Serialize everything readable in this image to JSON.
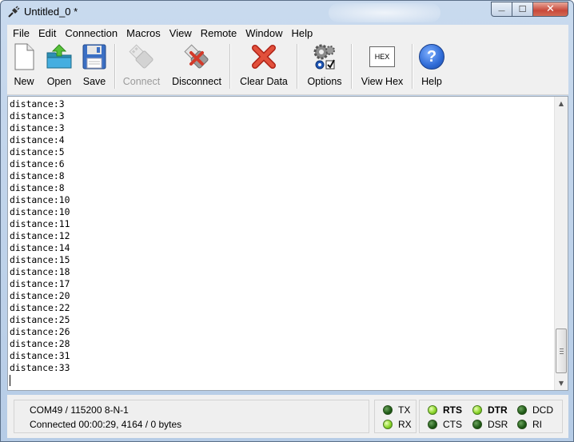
{
  "window": {
    "title": "Untitled_0 *",
    "close_glyph": "✕",
    "minimize_glyph": "—",
    "maximize_glyph": "☐"
  },
  "menu": [
    "File",
    "Edit",
    "Connection",
    "Macros",
    "View",
    "Remote",
    "Window",
    "Help"
  ],
  "toolbar": {
    "new": "New",
    "open": "Open",
    "save": "Save",
    "connect": "Connect",
    "disconnect": "Disconnect",
    "clear_data": "Clear Data",
    "options": "Options",
    "view_hex": "View Hex",
    "view_hex_icon_text": "HEX",
    "help": "Help",
    "help_icon_text": "?"
  },
  "terminal": {
    "lines": [
      "distance:3",
      "distance:3",
      "distance:3",
      "distance:4",
      "distance:5",
      "distance:6",
      "distance:8",
      "distance:8",
      "distance:10",
      "distance:10",
      "distance:11",
      "distance:12",
      "distance:14",
      "distance:15",
      "distance:18",
      "distance:17",
      "distance:20",
      "distance:22",
      "distance:25",
      "distance:26",
      "distance:28",
      "distance:31",
      "distance:33"
    ]
  },
  "status": {
    "port": "COM49 / 115200 8-N-1",
    "connection": "Connected 00:00:29, 4164 / 0 bytes"
  },
  "signals": {
    "tx": {
      "label": "TX",
      "state": "dark"
    },
    "rx": {
      "label": "RX",
      "state": "lit"
    },
    "rts": {
      "label": "RTS",
      "state": "lit"
    },
    "cts": {
      "label": "CTS",
      "state": "dark"
    },
    "dtr": {
      "label": "DTR",
      "state": "lit"
    },
    "dsr": {
      "label": "DSR",
      "state": "dark"
    },
    "dcd": {
      "label": "DCD",
      "state": "dark"
    },
    "ri": {
      "label": "RI",
      "state": "dark"
    }
  },
  "icons": {
    "app": "plug-icon",
    "new": "new-document-icon",
    "open": "open-folder-icon",
    "save": "floppy-disk-icon",
    "connect": "usb-plug-icon",
    "disconnect": "usb-disconnect-icon",
    "clear": "red-x-icon",
    "options": "gears-checkbox-icon",
    "hex": "hex-view-icon",
    "help": "help-question-icon"
  },
  "colors": {
    "led_lit": "#8ed62c",
    "led_dark": "#1f5a16",
    "help_blue": "#2f6bd6",
    "clear_red": "#d23a2a"
  }
}
